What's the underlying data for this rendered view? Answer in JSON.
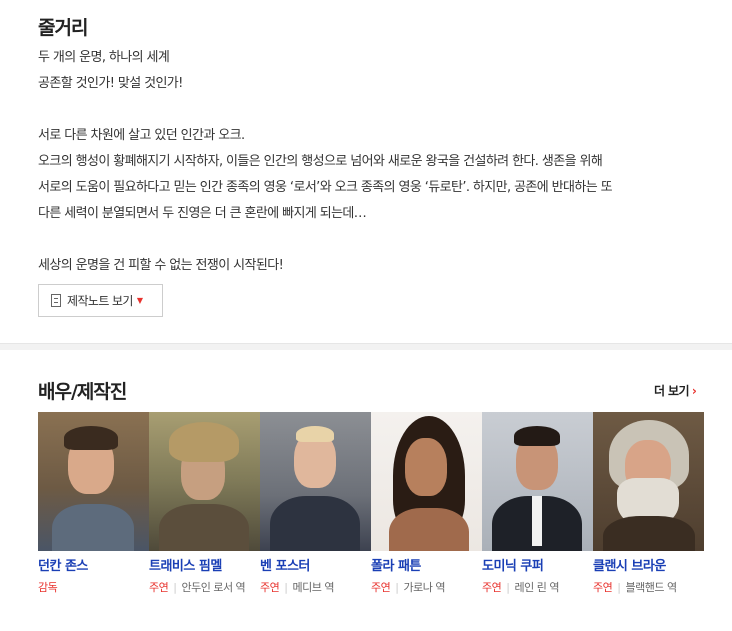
{
  "plot": {
    "title": "줄거리",
    "lines": [
      "두 개의 운명, 하나의 세계",
      "  공존할 것인가! 맞설 것인가!",
      "",
      "  서로 다른 차원에 살고 있던 인간과 오크.",
      "  오크의 행성이 황폐해지기 시작하자, 이들은 인간의 행성으로 넘어와 새로운 왕국을 건설하려 한다. 생존을 위해",
      "서로의 도움이 필요하다고 믿는 인간 종족의 영웅 ‘로서’와 오크 종족의 영웅 ‘듀로탄’. 하지만, 공존에 반대하는 또",
      "다른 세력이 분열되면서 두 진영은 더 큰 혼란에 빠지게 되는데…",
      "",
      "  세상의 운명을 건 피할 수 없는 전쟁이 시작된다!"
    ],
    "note_button": "제작노트 보기"
  },
  "cast_section": {
    "title": "배우/제작진",
    "more": "더 보기"
  },
  "cast": [
    {
      "name": "던칸 존스",
      "role": "감독",
      "character": ""
    },
    {
      "name": "트래비스 핌멜",
      "role": "주연",
      "character": "안두인 로서 역"
    },
    {
      "name": "벤 포스터",
      "role": "주연",
      "character": "메디브 역"
    },
    {
      "name": "폴라 패튼",
      "role": "주연",
      "character": "가로나 역"
    },
    {
      "name": "도미닉 쿠퍼",
      "role": "주연",
      "character": "레인 린 역"
    },
    {
      "name": "클랜시 브라운",
      "role": "주연",
      "character": "블랙핸드 역"
    }
  ]
}
